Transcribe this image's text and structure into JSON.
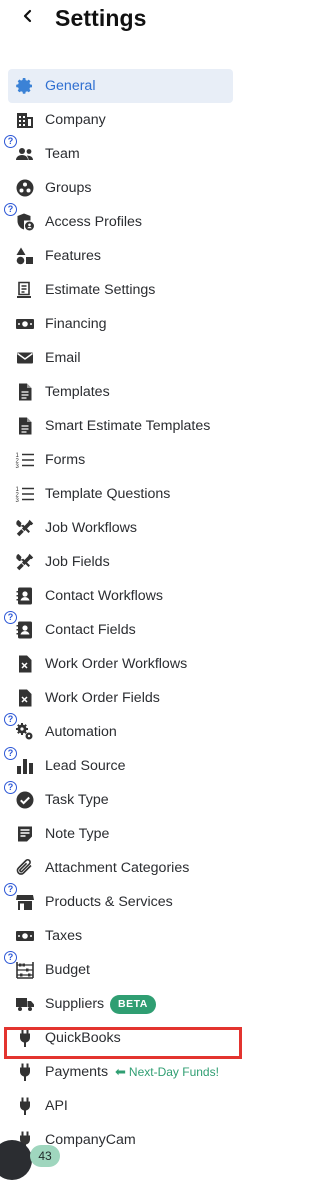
{
  "header": {
    "title": "Settings",
    "back_icon": "chevron-left-icon"
  },
  "menu": [
    {
      "label": "General",
      "icon": "gear-icon",
      "active": true
    },
    {
      "label": "Company",
      "icon": "building-icon"
    },
    {
      "label": "Team",
      "icon": "people-icon",
      "help": "?"
    },
    {
      "label": "Groups",
      "icon": "groups-icon"
    },
    {
      "label": "Access Profiles",
      "icon": "shield-user-icon",
      "help": "?"
    },
    {
      "label": "Features",
      "icon": "shapes-icon"
    },
    {
      "label": "Estimate Settings",
      "icon": "document-list-icon"
    },
    {
      "label": "Financing",
      "icon": "money-icon"
    },
    {
      "label": "Email",
      "icon": "envelope-icon"
    },
    {
      "label": "Templates",
      "icon": "file-icon"
    },
    {
      "label": "Smart Estimate Templates",
      "icon": "file-icon"
    },
    {
      "label": "Forms",
      "icon": "numbered-list-icon"
    },
    {
      "label": "Template Questions",
      "icon": "numbered-list-icon"
    },
    {
      "label": "Job Workflows",
      "icon": "tools-icon"
    },
    {
      "label": "Job Fields",
      "icon": "tools-icon"
    },
    {
      "label": "Contact Workflows",
      "icon": "contact-book-icon"
    },
    {
      "label": "Contact Fields",
      "icon": "contact-book-icon",
      "help": "?"
    },
    {
      "label": "Work Order Workflows",
      "icon": "work-order-icon"
    },
    {
      "label": "Work Order Fields",
      "icon": "work-order-icon"
    },
    {
      "label": "Automation",
      "icon": "gears-icon",
      "help": "?"
    },
    {
      "label": "Lead Source",
      "icon": "bar-chart-icon",
      "help": "?"
    },
    {
      "label": "Task Type",
      "icon": "check-circle-icon",
      "help": "?"
    },
    {
      "label": "Note Type",
      "icon": "note-icon"
    },
    {
      "label": "Attachment Categories",
      "icon": "paperclip-icon"
    },
    {
      "label": "Products & Services",
      "icon": "store-icon",
      "help": "?"
    },
    {
      "label": "Taxes",
      "icon": "money-icon"
    },
    {
      "label": "Budget",
      "icon": "abacus-icon",
      "help": "?"
    },
    {
      "label": "Suppliers",
      "icon": "truck-icon",
      "badge": "BETA"
    },
    {
      "label": "QuickBooks",
      "icon": "plug-icon"
    },
    {
      "label": "Payments",
      "icon": "plug-icon",
      "promo": "Next-Day Funds!"
    },
    {
      "label": "API",
      "icon": "plug-icon"
    },
    {
      "label": "CompanyCam",
      "icon": "plug-icon"
    }
  ],
  "colors": {
    "active_text": "#2f6fd1",
    "active_bg": "#e8eef7",
    "beta_badge": "#2f9e72",
    "promo_text": "#2f9e72",
    "highlight_border": "#e3342f",
    "help_icon": "#2c57d6"
  },
  "footer": {
    "notification_count": "43"
  }
}
